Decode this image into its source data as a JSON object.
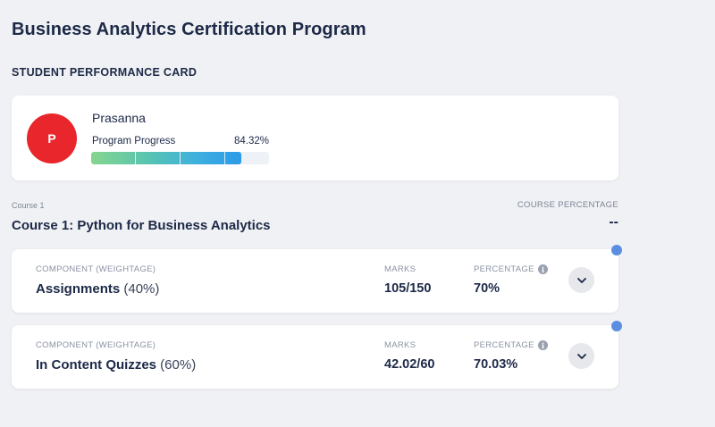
{
  "page": {
    "title": "Business Analytics Certification Program",
    "section_label": "STUDENT PERFORMANCE CARD"
  },
  "student": {
    "avatar_initial": "P",
    "name": "Prasanna",
    "progress_label": "Program Progress",
    "progress_text": "84.32%",
    "progress_fraction": 0.8432,
    "avatar_color": "#e8262b"
  },
  "course": {
    "small_label": "Course 1",
    "title": "Course 1: Python for Business Analytics",
    "percentage_label": "COURSE PERCENTAGE",
    "percentage_value": "--"
  },
  "components": [
    {
      "header_label": "COMPONENT (WEIGHTAGE)",
      "name": "Assignments",
      "weight": "(40%)",
      "marks_label": "MARKS",
      "marks": "105/150",
      "percentage_label": "PERCENTAGE",
      "percentage": "70%"
    },
    {
      "header_label": "COMPONENT (WEIGHTAGE)",
      "name": "In Content Quizzes",
      "weight": "(60%)",
      "marks_label": "MARKS",
      "marks": "42.02/60",
      "percentage_label": "PERCENTAGE",
      "percentage": "70.03%"
    }
  ],
  "icons": {
    "info": "info-icon",
    "expand": "chevron-down-icon"
  }
}
